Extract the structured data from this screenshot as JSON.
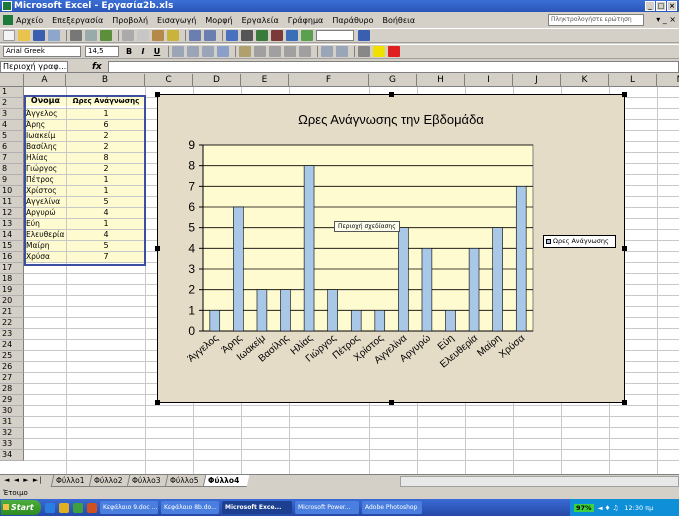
{
  "window": {
    "title": "Microsoft Excel - Εργασία2b.xls"
  },
  "menu": {
    "items": [
      "Αρχείο",
      "Επεξεργασία",
      "Προβολή",
      "Εισαγωγή",
      "Μορφή",
      "Εργαλεία",
      "Γράφημα",
      "Παράθυρο",
      "Βοήθεια"
    ],
    "help_placeholder": "Πληκτρολογήστε ερώτηση"
  },
  "format_toolbar": {
    "font": "Arial Greek",
    "size": "14,5"
  },
  "formula_bar": {
    "name_box": "Περιοχή γραφ..."
  },
  "sheet": {
    "columns": [
      "A",
      "B",
      "C",
      "D",
      "E",
      "F",
      "G",
      "H",
      "I",
      "J",
      "K",
      "L",
      "M",
      "N"
    ],
    "rows": [
      "1",
      "2",
      "3",
      "4",
      "5",
      "6",
      "7",
      "8",
      "9",
      "10",
      "11",
      "12",
      "13",
      "14",
      "15",
      "16",
      "17",
      "18",
      "19",
      "20",
      "21",
      "22",
      "23",
      "24",
      "25",
      "26",
      "27",
      "28",
      "29",
      "30",
      "31",
      "32",
      "33",
      "34"
    ],
    "header": {
      "name": "Ονομα",
      "hours": "Ωρες Ανάγνωσης"
    },
    "data": [
      [
        "Άγγελος",
        "1"
      ],
      [
        "Άρης",
        "6"
      ],
      [
        "Ιωακείμ",
        "2"
      ],
      [
        "Βασίλης",
        "2"
      ],
      [
        "Ηλίας",
        "8"
      ],
      [
        "Γιώργος",
        "2"
      ],
      [
        "Πέτρος",
        "1"
      ],
      [
        "Χρίστος",
        "1"
      ],
      [
        "Αγγελίνα",
        "5"
      ],
      [
        "Αργυρώ",
        "4"
      ],
      [
        "Εύη",
        "1"
      ],
      [
        "Ελευθερία",
        "4"
      ],
      [
        "Μαίρη",
        "5"
      ],
      [
        "Χρύσα",
        "7"
      ]
    ]
  },
  "chart_data": {
    "type": "bar",
    "title": "Ωρες Ανάγνωσης την Εβδομάδα",
    "categories": [
      "Άγγελος",
      "Άρης",
      "Ιωακείμ",
      "Βασίλης",
      "Ηλίας",
      "Γιώργος",
      "Πέτρος",
      "Χρίστος",
      "Αγγελίνα",
      "Αργυρώ",
      "Εύη",
      "Ελευθερία",
      "Μαίρη",
      "Χρύσα"
    ],
    "series": [
      {
        "name": "Ωρες Ανάγνωσης",
        "values": [
          1,
          6,
          2,
          2,
          8,
          2,
          1,
          1,
          5,
          4,
          1,
          4,
          5,
          7
        ]
      }
    ],
    "yticks": [
      "0",
      "1",
      "2",
      "3",
      "4",
      "5",
      "6",
      "7",
      "8",
      "9"
    ],
    "ylim": [
      0,
      9
    ],
    "grid": true,
    "legend": "right",
    "tooltip": "Περιοχή σχεδίασης",
    "colors": {
      "bar": "#a9c8e8",
      "plot_bg": "#fffbd0",
      "chart_bg": "#e5dcc8"
    }
  },
  "sheet_tabs": {
    "nav": "◄ ◄ ► ►|",
    "tabs": [
      "Φύλλο1",
      "Φύλλο2",
      "Φύλλο3",
      "Φύλλο5",
      "Φύλλο4"
    ],
    "active_index": 4
  },
  "status": {
    "text": "Έτοιμο"
  },
  "taskbar": {
    "start": "Start",
    "buttons": [
      "Κεφάλαιο 9.doc ...",
      "Κεφάλαιο 8b.do...",
      "Microsoft Exce...",
      "Microsoft Power...",
      "Adobe Photoshop"
    ],
    "active_index": 2,
    "battery": "97%",
    "clock": "12:30 πμ"
  }
}
